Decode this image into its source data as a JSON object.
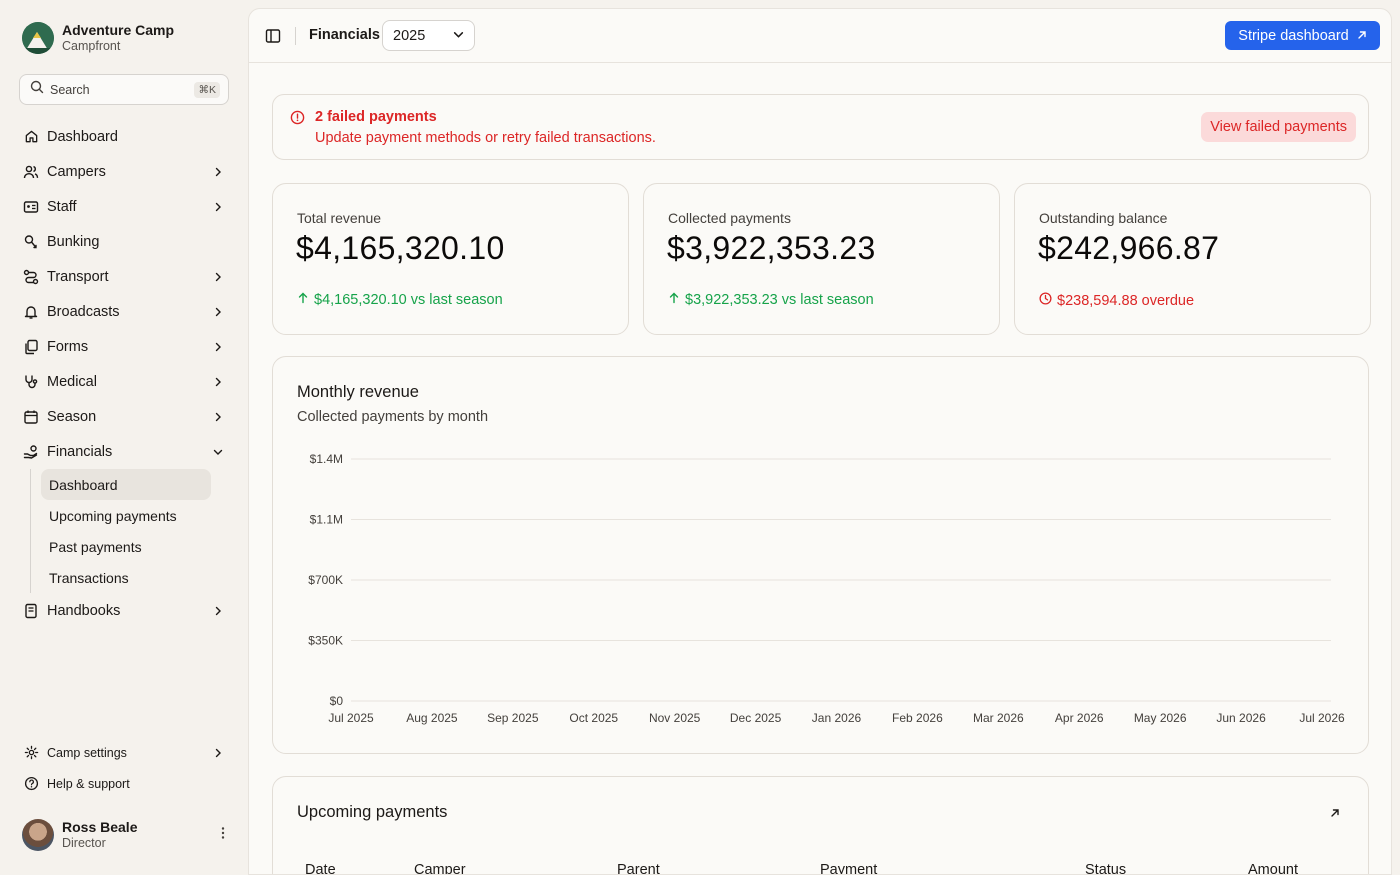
{
  "brand": {
    "name": "Adventure Camp",
    "subtitle": "Campfront",
    "icon": "mountain-logo"
  },
  "search": {
    "label": "Search",
    "shortcut": "⌘K"
  },
  "sidebar": {
    "items": [
      {
        "label": "Dashboard",
        "icon": "home-icon"
      },
      {
        "label": "Campers",
        "icon": "users-icon"
      },
      {
        "label": "Staff",
        "icon": "id-card-icon"
      },
      {
        "label": "Bunking",
        "icon": "bunk-icon"
      },
      {
        "label": "Transport",
        "icon": "route-icon"
      },
      {
        "label": "Broadcasts",
        "icon": "bell-icon"
      },
      {
        "label": "Forms",
        "icon": "forms-icon"
      },
      {
        "label": "Medical",
        "icon": "stethoscope-icon"
      },
      {
        "label": "Season",
        "icon": "calendar-icon"
      },
      {
        "label": "Financials",
        "icon": "hand-coins-icon"
      }
    ],
    "financials_sub": [
      "Dashboard",
      "Upcoming payments",
      "Past payments",
      "Transactions"
    ],
    "handbooks": "Handbooks",
    "camp_settings": "Camp settings",
    "help": "Help & support"
  },
  "user": {
    "name": "Ross Beale",
    "role": "Director"
  },
  "topbar": {
    "breadcrumb": "Financials",
    "year": "2025",
    "stripe_label": "Stripe dashboard"
  },
  "alert": {
    "title": "2 failed payments",
    "message": "Update payment methods or retry failed transactions.",
    "button": "View failed payments"
  },
  "stats": [
    {
      "label": "Total revenue",
      "value": "$4,165,320.10",
      "foot": "$4,165,320.10 vs last season"
    },
    {
      "label": "Collected payments",
      "value": "$3,922,353.23",
      "foot": "$3,922,353.23 vs last season"
    },
    {
      "label": "Outstanding balance",
      "value": "$242,966.87",
      "foot": "$238,594.88 overdue"
    }
  ],
  "colors": {
    "accent": "#2563eb",
    "danger": "#dc2626",
    "success": "#16a34a"
  },
  "chart_data": {
    "type": "line",
    "title": "Monthly revenue",
    "subtitle": "Collected payments by month",
    "categories": [
      "Jul 2025",
      "Aug 2025",
      "Sep 2025",
      "Oct 2025",
      "Nov 2025",
      "Dec 2025",
      "Jan 2026",
      "Feb 2026",
      "Mar 2026",
      "Apr 2026",
      "May 2026",
      "Jun 2026",
      "Jul 2026"
    ],
    "y_ticks": [
      "$0",
      "$350K",
      "$700K",
      "$1.1M",
      "$1.4M"
    ],
    "ylim": [
      0,
      1400000
    ],
    "grid": true,
    "series": []
  },
  "upcoming": {
    "title": "Upcoming payments",
    "columns": [
      "Date",
      "Camper",
      "Parent",
      "Payment",
      "Status",
      "Amount"
    ]
  }
}
